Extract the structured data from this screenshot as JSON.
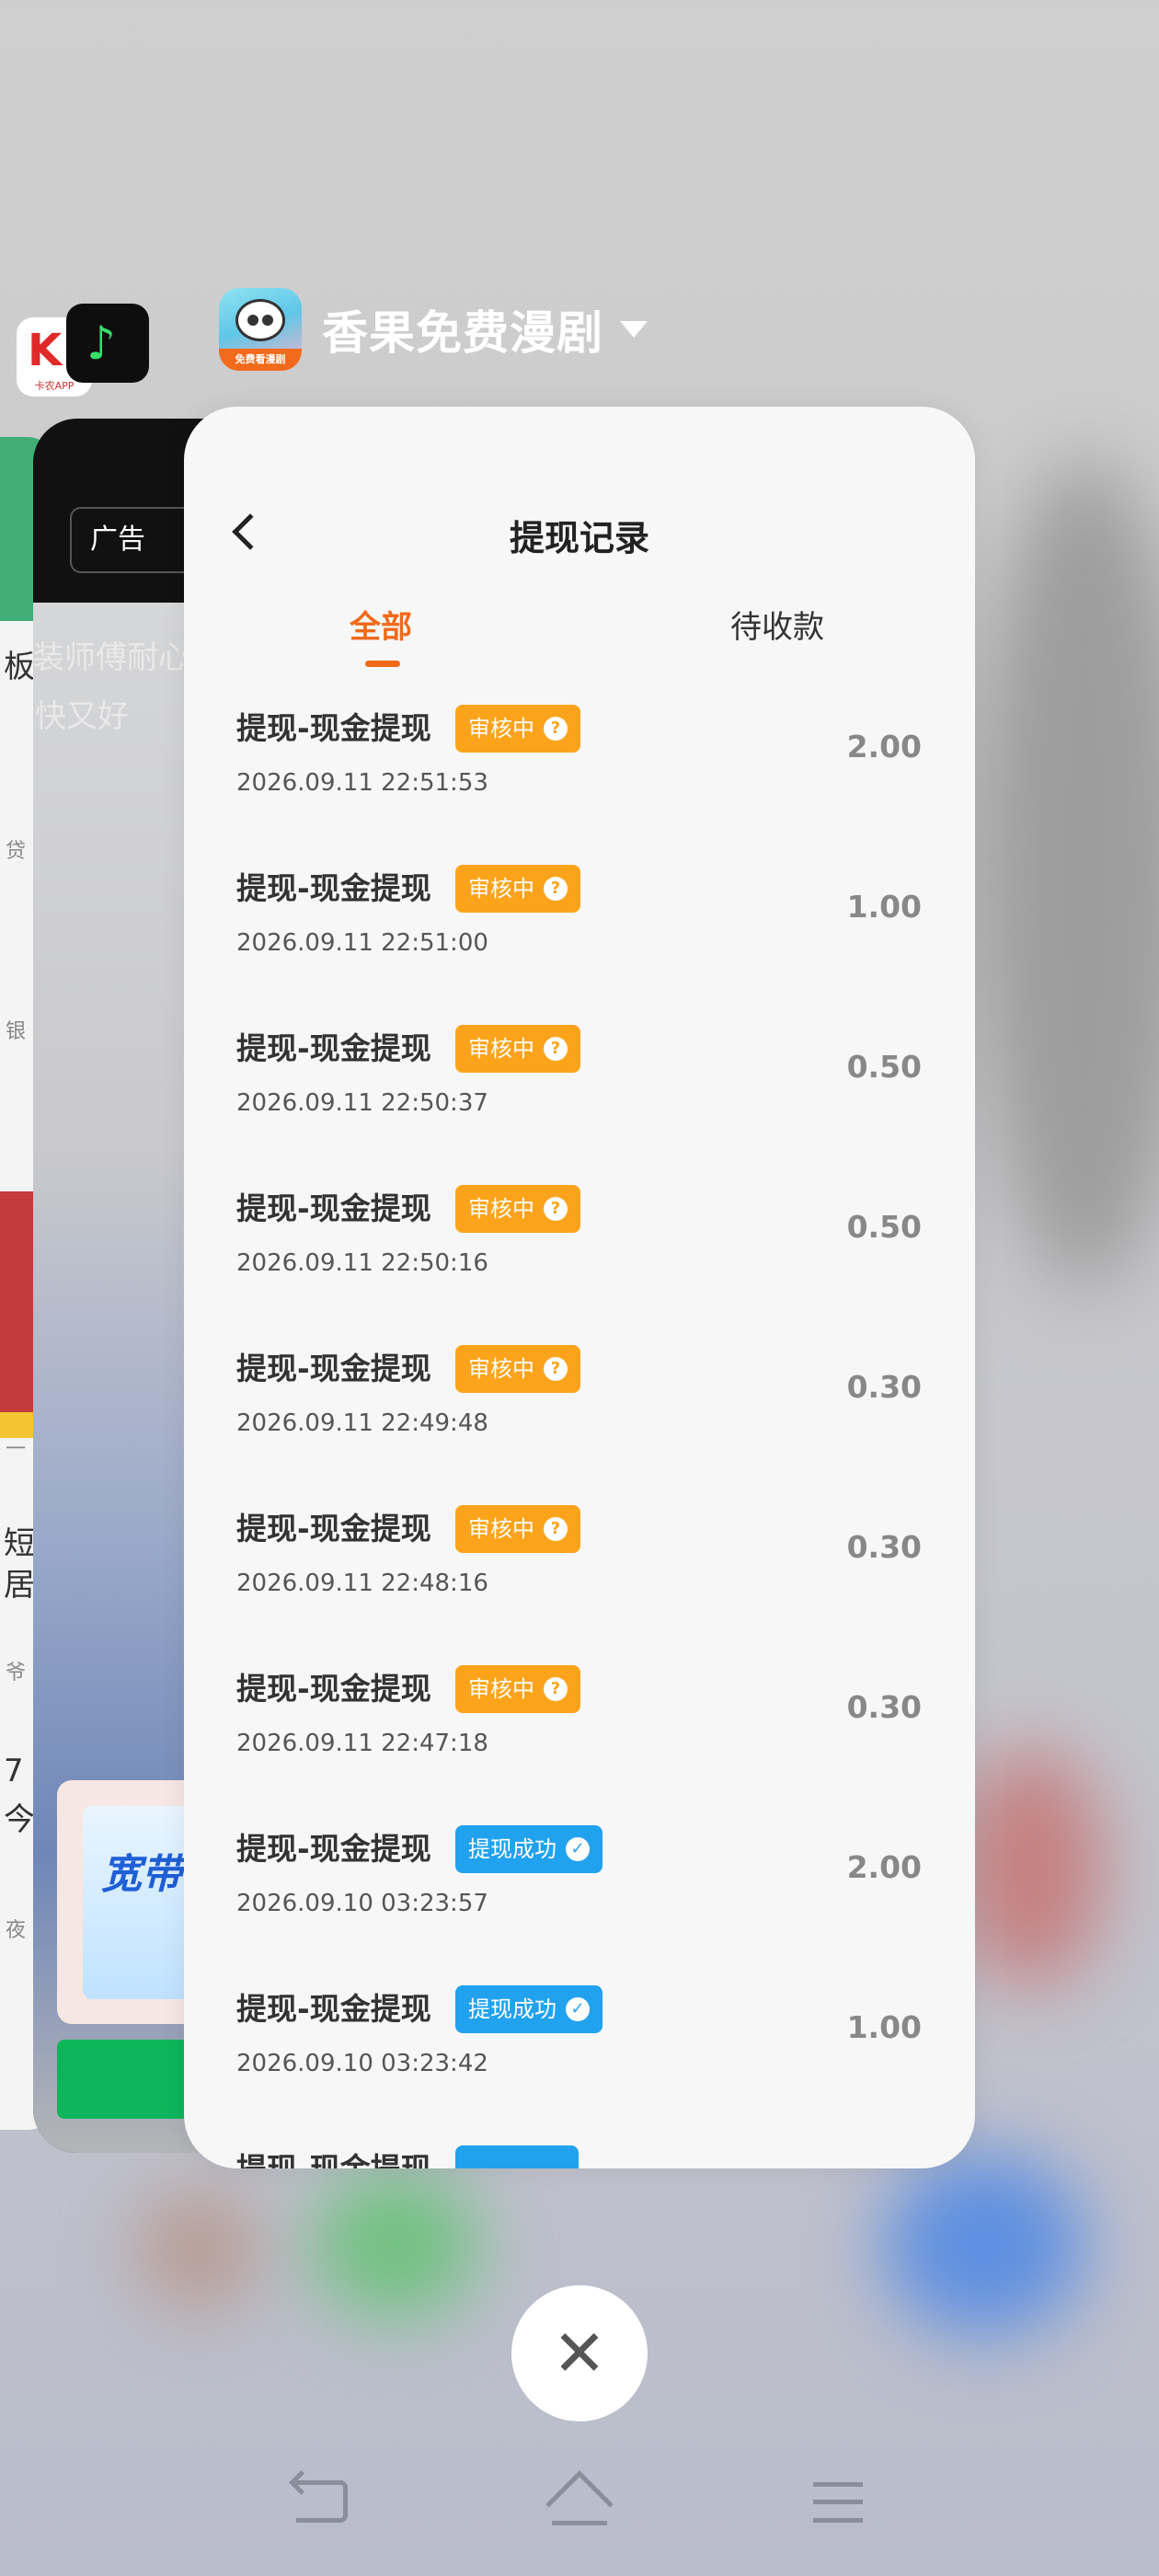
{
  "app_header": {
    "name": "香果免费漫剧",
    "icon_label": "免费看漫剧"
  },
  "mini_apps": {
    "first_label": "卡农APP"
  },
  "background_cards": {
    "far_texts": [
      "板",
      "贷",
      "银",
      "一",
      "短",
      "居",
      "爷",
      "7",
      "今",
      "夜"
    ],
    "mid_ad": "广告",
    "mid_texts": [
      "装师傅耐心",
      "快又好"
    ],
    "banner_word": "宽带"
  },
  "sheet": {
    "title": "提现记录",
    "tabs": [
      {
        "label": "全部",
        "active": true
      },
      {
        "label": "待收款",
        "active": false
      }
    ],
    "records": [
      {
        "name": "提现-现金提现",
        "status": "审核中",
        "status_type": "review",
        "time": "2026.09.11 22:51:53",
        "amount": "2.00"
      },
      {
        "name": "提现-现金提现",
        "status": "审核中",
        "status_type": "review",
        "time": "2026.09.11 22:51:00",
        "amount": "1.00"
      },
      {
        "name": "提现-现金提现",
        "status": "审核中",
        "status_type": "review",
        "time": "2026.09.11 22:50:37",
        "amount": "0.50"
      },
      {
        "name": "提现-现金提现",
        "status": "审核中",
        "status_type": "review",
        "time": "2026.09.11 22:50:16",
        "amount": "0.50"
      },
      {
        "name": "提现-现金提现",
        "status": "审核中",
        "status_type": "review",
        "time": "2026.09.11 22:49:48",
        "amount": "0.30"
      },
      {
        "name": "提现-现金提现",
        "status": "审核中",
        "status_type": "review",
        "time": "2026.09.11 22:48:16",
        "amount": "0.30"
      },
      {
        "name": "提现-现金提现",
        "status": "审核中",
        "status_type": "review",
        "time": "2026.09.11 22:47:18",
        "amount": "0.30"
      },
      {
        "name": "提现-现金提现",
        "status": "提现成功",
        "status_type": "success",
        "time": "2026.09.10 03:23:57",
        "amount": "2.00"
      },
      {
        "name": "提现-现金提现",
        "status": "提现成功",
        "status_type": "success",
        "time": "2026.09.10 03:23:42",
        "amount": "1.00"
      },
      {
        "name": "提现-现金提现",
        "status": "",
        "status_type": "success",
        "time": "",
        "amount": ""
      }
    ]
  },
  "colors": {
    "accent": "#f06a1a",
    "review": "#fba41b",
    "success": "#21a2ee"
  },
  "icons": {
    "close": "close-icon",
    "back": "back-icon",
    "home": "home-icon",
    "menu": "menu-icon"
  }
}
